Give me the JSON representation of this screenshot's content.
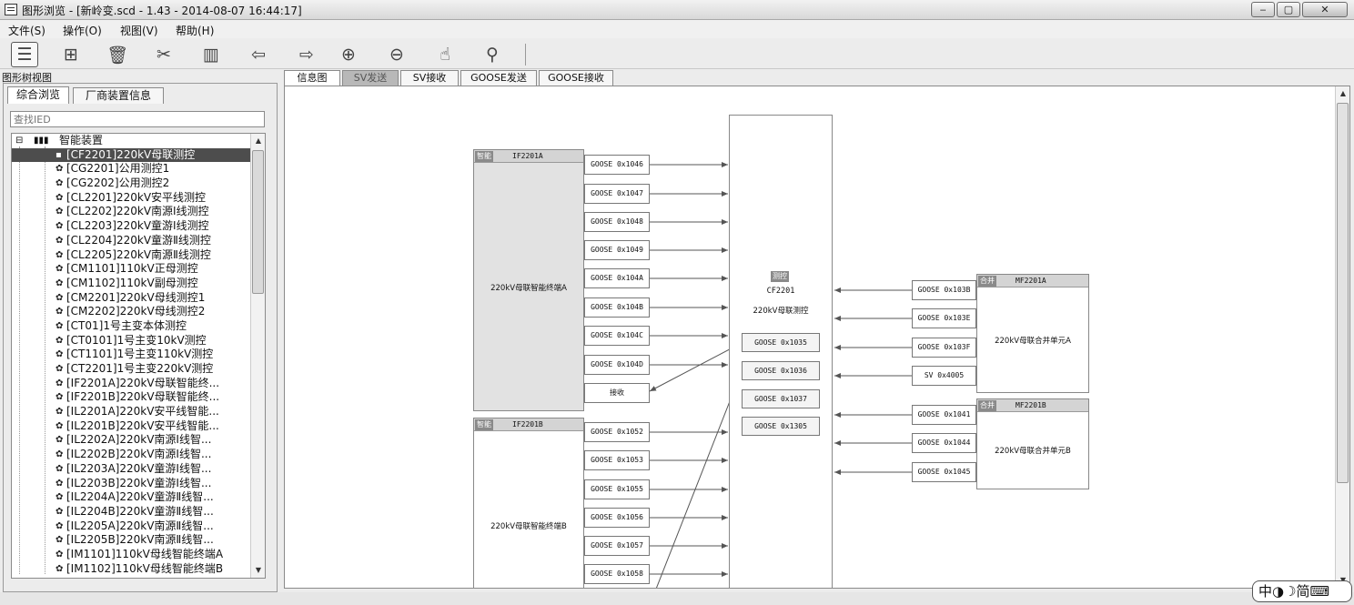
{
  "window": {
    "title": "图形浏览 - [新岭变.scd - 1.43 - 2014-08-07 16:44:17]",
    "buttons": [
      "‒",
      "▢",
      "✕"
    ]
  },
  "menu": [
    "文件(S)",
    "操作(O)",
    "视图(V)",
    "帮助(H)"
  ],
  "toolbar": [
    {
      "icon": "list-icon",
      "glyph": "☰"
    },
    {
      "icon": "unlock-icon",
      "glyph": "⊞"
    },
    {
      "icon": "trash-icon",
      "glyph": "🗑"
    },
    {
      "icon": "tools-icon",
      "glyph": "✂"
    },
    {
      "icon": "columns-icon",
      "glyph": "▥"
    },
    {
      "icon": "back-arrow-icon",
      "glyph": "⇦"
    },
    {
      "icon": "forward-arrow-icon",
      "glyph": "⇨"
    },
    {
      "icon": "zoom-in-icon",
      "glyph": "⊕"
    },
    {
      "icon": "zoom-out-icon",
      "glyph": "⊖"
    },
    {
      "icon": "hand-pan-icon",
      "glyph": "☝"
    },
    {
      "icon": "pin-search-icon",
      "glyph": "⚲"
    }
  ],
  "left": {
    "caption": "图形树视图",
    "tabs": [
      "综合浏览",
      "厂商装置信息"
    ],
    "search_placeholder": "查找IED",
    "root": "智能装置",
    "items": [
      "[CF2201]220kV母联测控",
      "[CG2201]公用测控1",
      "[CG2202]公用测控2",
      "[CL2201]220kV安平线测控",
      "[CL2202]220kV南源Ⅰ线测控",
      "[CL2203]220kV童游Ⅰ线测控",
      "[CL2204]220kV童游Ⅱ线测控",
      "[CL2205]220kV南源Ⅱ线测控",
      "[CM1101]110kV正母测控",
      "[CM1102]110kV副母测控",
      "[CM2201]220kV母线测控1",
      "[CM2202]220kV母线测控2",
      "[CT01]1号主变本体测控",
      "[CT0101]1号主变10kV测控",
      "[CT1101]1号主变110kV测控",
      "[CT2201]1号主变220kV测控",
      "[IF2201A]220kV母联智能终...",
      "[IF2201B]220kV母联智能终...",
      "[IL2201A]220kV安平线智能...",
      "[IL2201B]220kV安平线智能...",
      "[IL2202A]220kV南源Ⅰ线智...",
      "[IL2202B]220kV南源Ⅰ线智...",
      "[IL2203A]220kV童游Ⅰ线智...",
      "[IL2203B]220kV童游Ⅰ线智...",
      "[IL2204A]220kV童游Ⅱ线智...",
      "[IL2204B]220kV童游Ⅱ线智...",
      "[IL2205A]220kV南源Ⅱ线智...",
      "[IL2205B]220kV南源Ⅱ线智...",
      "[IM1101]110kV母线智能终端A",
      "[IM1102]110kV母线智能终端B"
    ],
    "selected_index": 0
  },
  "tabs": [
    "信息图",
    "SV发送",
    "SV接收",
    "GOOSE发送",
    "GOOSE接收"
  ],
  "diagram": {
    "center": {
      "tag": "测控",
      "id": "CF2201",
      "name": "220kV母联测控",
      "outputs": [
        "GOOSE 0x1035",
        "GOOSE 0x1036",
        "GOOSE 0x1037",
        "GOOSE 0x1305"
      ]
    },
    "if_a": {
      "tag": "智能",
      "id": "IF2201A",
      "name": "220kV母联智能终端A",
      "ports": [
        "GOOSE 0x1046",
        "GOOSE 0x1047",
        "GOOSE 0x1048",
        "GOOSE 0x1049",
        "GOOSE 0x104A",
        "GOOSE 0x104B",
        "GOOSE 0x104C",
        "GOOSE 0x104D"
      ],
      "recv": "接收"
    },
    "if_b": {
      "tag": "智能",
      "id": "IF2201B",
      "name": "220kV母联智能终端B",
      "ports": [
        "GOOSE 0x1052",
        "GOOSE 0x1053",
        "GOOSE 0x1055",
        "GOOSE 0x1056",
        "GOOSE 0x1057",
        "GOOSE 0x1058"
      ]
    },
    "mf_a": {
      "tag": "合并",
      "id": "MF2201A",
      "name": "220kV母联合并单元A",
      "ports": [
        "GOOSE 0x103B",
        "GOOSE 0x103E",
        "GOOSE 0x103F",
        "SV 0x4005"
      ]
    },
    "mf_b": {
      "tag": "合并",
      "id": "MF2201B",
      "name": "220kV母联合并单元B",
      "ports": [
        "GOOSE 0x1041",
        "GOOSE 0x1044",
        "GOOSE 0x1045"
      ]
    }
  },
  "ime": "中◑☽简⌨"
}
